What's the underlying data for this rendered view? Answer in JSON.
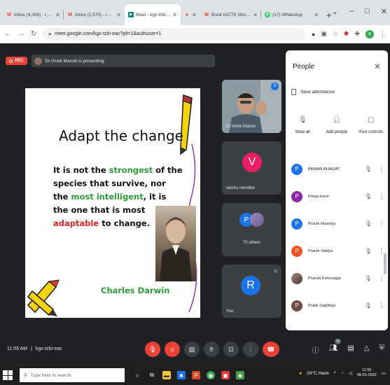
{
  "browser": {
    "tabs": [
      {
        "title": "Inbox (4,268) - roshan.kumar...",
        "favicon": "gmail-icon",
        "color": "#ea4335",
        "active": false
      },
      {
        "title": "Inbox (1,570) - rajan.kumar@...",
        "favicon": "gmail-icon",
        "color": "#ea4335",
        "active": false
      },
      {
        "title": "Meet - kgx-tzbi-eac",
        "favicon": "meet-icon",
        "color": "#00897b",
        "active": true
      },
      {
        "title": "",
        "favicon": "recording-icon",
        "color": "#ea4335",
        "active": false
      },
      {
        "title": "Book IACTE Workshop on E...",
        "favicon": "gmail-icon",
        "color": "#ea4335",
        "active": false
      },
      {
        "title": "(17) WhatsApp",
        "favicon": "whatsapp-icon",
        "color": "#25d366",
        "active": false
      }
    ],
    "new_tab": "+",
    "window_controls": {
      "minimize": "–",
      "maximize": "□",
      "close": "✕",
      "dropdown": "⌄"
    },
    "url": "meet.google.com/kgx-tzbi-eac?pli=1&authuser=1"
  },
  "meet": {
    "rec_label": "REC",
    "presenting_text": "Dr.Vivek Manoti is presenting",
    "slide": {
      "title": "Adapt the change",
      "quote_parts": [
        {
          "text": "It is not the ",
          "color": "black"
        },
        {
          "text": "strongest",
          "color": "green"
        },
        {
          "text": " of the species that survive, nor the ",
          "color": "black"
        },
        {
          "text": "most intelligent",
          "color": "green"
        },
        {
          "text": ", it is the one that is most ",
          "color": "black"
        },
        {
          "text": "adaptable",
          "color": "red"
        },
        {
          "text": " to change.",
          "color": "black"
        }
      ],
      "author": "Charles Darwin"
    },
    "tiles": [
      {
        "name": "Dr.Vivek Manoti",
        "type": "video"
      },
      {
        "name": "vaishu mendhe",
        "initial": "V",
        "color": "#e91e63"
      },
      {
        "name": "70 others",
        "initial": "P",
        "color": "#1a73e8"
      },
      {
        "name": "You",
        "initial": "R",
        "color": "#1a73e8"
      }
    ],
    "people": {
      "title": "People",
      "save_attendance": "Save attendance",
      "actions": [
        {
          "label": "Mute all",
          "icon": "mic-off-icon"
        },
        {
          "label": "Add people",
          "icon": "add-person-icon"
        },
        {
          "label": "Host controls",
          "icon": "host-controls-icon"
        }
      ],
      "participants": [
        {
          "name": "PAWAN BHAGAT",
          "initial": "P",
          "color": "#1a73e8"
        },
        {
          "name": "Pooja Kane",
          "initial": "P",
          "color": "#8e24aa"
        },
        {
          "name": "Prachi Hisariya",
          "initial": "P",
          "color": "#1a73e8"
        },
        {
          "name": "Prachi Vaidya",
          "initial": "P",
          "color": "#f4511e"
        },
        {
          "name": "Pranali Kshirsagar",
          "initial": "",
          "color": "#6d4c41"
        },
        {
          "name": "Pratik Gajbhiye",
          "initial": "P",
          "color": "#6d4c41"
        }
      ]
    },
    "bottom": {
      "time": "11:55 AM",
      "separator": "|",
      "meeting_code": "kgx-tzbi-eac",
      "participant_count": "76"
    }
  },
  "taskbar": {
    "search_placeholder": "Type here to search",
    "weather": "24°C Haze",
    "time": "11:55",
    "date": "08-01-2022"
  }
}
